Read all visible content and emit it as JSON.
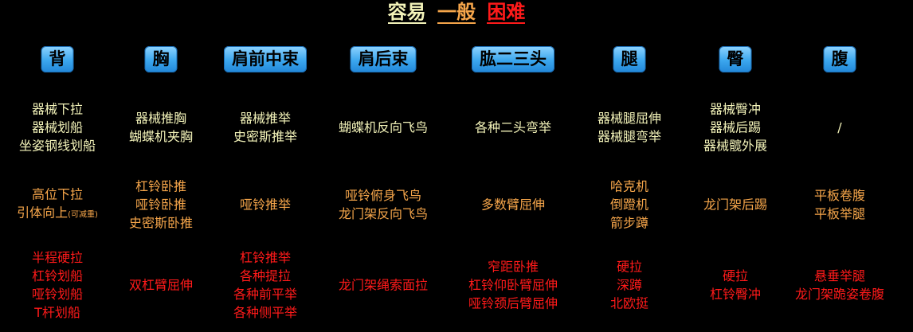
{
  "legend": {
    "easy": {
      "label": "容易",
      "color": "#f3f3b9"
    },
    "medium": {
      "label": "一般",
      "color": "#f5a54a"
    },
    "hard": {
      "label": "困难",
      "color": "#ff1a1a"
    }
  },
  "columns": [
    {
      "header": "背",
      "easy": [
        "器械下拉",
        "器械划船",
        "坐姿钢线划船"
      ],
      "medium": [
        "高位下拉",
        "引体向上"
      ],
      "medium_note": "(可减重)",
      "hard": [
        "半程硬拉",
        "杠铃划船",
        "哑铃划船",
        "T杆划船"
      ]
    },
    {
      "header": "胸",
      "easy": [
        "器械推胸",
        "蝴蝶机夹胸"
      ],
      "medium": [
        "杠铃卧推",
        "哑铃卧推",
        "史密斯卧推"
      ],
      "hard": [
        "双杠臂屈伸"
      ]
    },
    {
      "header": "肩前中束",
      "easy": [
        "器械推举",
        "史密斯推举"
      ],
      "medium": [
        "哑铃推举"
      ],
      "hard": [
        "杠铃推举",
        "各种提拉",
        "各种前平举",
        "各种侧平举"
      ]
    },
    {
      "header": "肩后束",
      "easy": [
        "蝴蝶机反向飞鸟"
      ],
      "medium": [
        "哑铃俯身飞鸟",
        "龙门架反向飞鸟"
      ],
      "hard": [
        "龙门架绳索面拉"
      ]
    },
    {
      "header": "肱二三头",
      "easy": [
        "各种二头弯举"
      ],
      "medium": [
        "多数臂屈伸"
      ],
      "hard": [
        "窄距卧推",
        "杠铃仰卧臂屈伸",
        "哑铃颈后臂屈伸"
      ]
    },
    {
      "header": "腿",
      "easy": [
        "器械腿屈伸",
        "器械腿弯举"
      ],
      "medium": [
        "哈克机",
        "倒蹬机",
        "箭步蹲"
      ],
      "hard": [
        "硬拉",
        "深蹲",
        "北欧挺"
      ]
    },
    {
      "header": "臀",
      "easy": [
        "器械臀冲",
        "器械后踢",
        "器械髋外展"
      ],
      "medium": [
        "龙门架后踢"
      ],
      "hard": [
        "硬拉",
        "杠铃臀冲"
      ]
    },
    {
      "header": "腹",
      "easy": [
        "/"
      ],
      "medium": [
        "平板卷腹",
        "平板举腿"
      ],
      "hard": [
        "悬垂举腿",
        "龙门架跪姿卷腹"
      ]
    }
  ]
}
